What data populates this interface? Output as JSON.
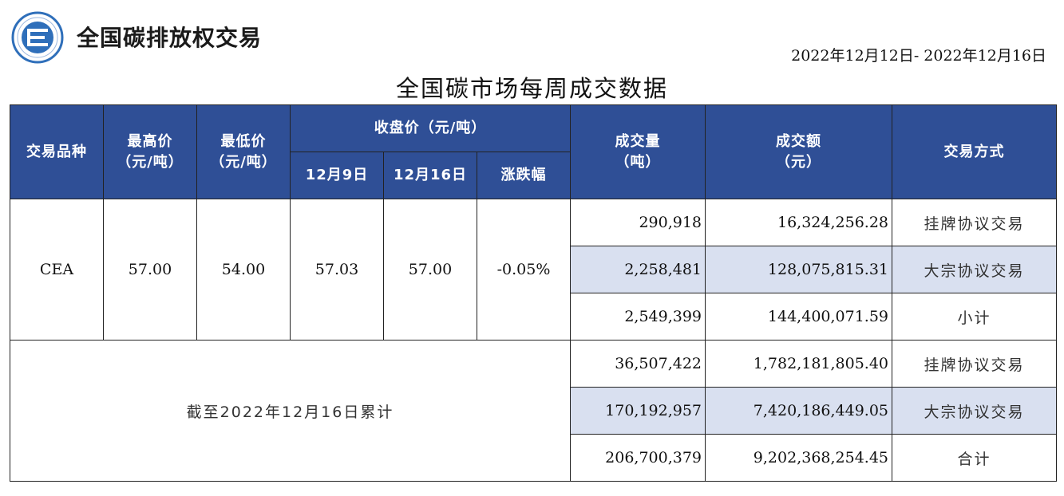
{
  "header": {
    "brand": "全国碳排放权交易",
    "date_range": "2022年12月12日- 2022年12月16日",
    "title": "全国碳市场每周成交数据"
  },
  "colors": {
    "header_bg": "#2f4f96",
    "shade_bg": "#d9e0f0",
    "logo_blue": "#2f6fba"
  },
  "table": {
    "headers": {
      "product": "交易品种",
      "high_1": "最高价",
      "high_2": "（元/吨）",
      "low_1": "最低价",
      "low_2": "（元/吨）",
      "close": "收盘价（元/吨）",
      "close_prev": "12月9日",
      "close_cur": "12月16日",
      "change": "涨跌幅",
      "volume_1": "成交量",
      "volume_2": "（吨）",
      "amount_1": "成交额",
      "amount_2": "（元）",
      "method": "交易方式"
    },
    "weekly": {
      "product": "CEA",
      "high": "57.00",
      "low": "54.00",
      "close_prev": "57.03",
      "close_cur": "57.00",
      "change": "-0.05%",
      "rows": [
        {
          "volume": "290,918",
          "amount": "16,324,256.28",
          "method": "挂牌协议交易"
        },
        {
          "volume": "2,258,481",
          "amount": "128,075,815.31",
          "method": "大宗协议交易"
        },
        {
          "volume": "2,549,399",
          "amount": "144,400,071.59",
          "method": "小计"
        }
      ]
    },
    "cumulative": {
      "label": "截至2022年12月16日累计",
      "rows": [
        {
          "volume": "36,507,422",
          "amount": "1,782,181,805.40",
          "method": "挂牌协议交易"
        },
        {
          "volume": "170,192,957",
          "amount": "7,420,186,449.05",
          "method": "大宗协议交易"
        },
        {
          "volume": "206,700,379",
          "amount": "9,202,368,254.45",
          "method": "合计"
        }
      ]
    }
  }
}
